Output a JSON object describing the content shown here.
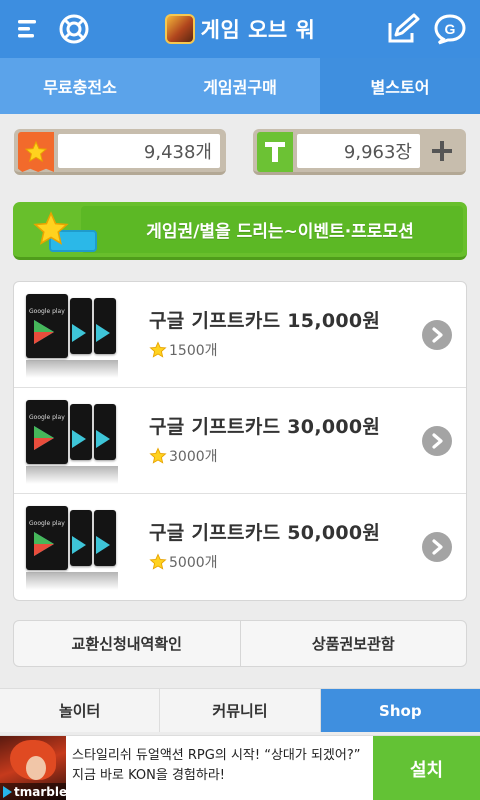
{
  "header": {
    "title": "게임 오브 워",
    "left_icons": [
      "menu-icon",
      "lifebuoy-icon"
    ],
    "right_icons": [
      "edit-icon",
      "g-chat-icon"
    ],
    "color": "#3d8ee0"
  },
  "tabs": [
    {
      "label": "무료충전소",
      "active": false
    },
    {
      "label": "게임권구매",
      "active": false
    },
    {
      "label": "별스토어",
      "active": true
    }
  ],
  "balances": {
    "stars": {
      "value": "9,438개",
      "icon": "star-icon"
    },
    "tickets": {
      "value": "9,963장",
      "icon": "t-ticket-icon",
      "add_icon": "plus-icon"
    }
  },
  "promo": {
    "label": "게임권/별을 드리는~이벤트·프로모션",
    "color": "#68bf2c"
  },
  "products": [
    {
      "name": "구글 기프트카드 15,000원",
      "price": "1500개",
      "card_brand": "Google play"
    },
    {
      "name": "구글 기프트카드 30,000원",
      "price": "3000개",
      "card_brand": "Google play"
    },
    {
      "name": "구글 기프트카드 50,000원",
      "price": "5000개",
      "card_brand": "Google play"
    }
  ],
  "actions": {
    "history": "교환신청내역확인",
    "vault": "상품권보관함"
  },
  "bottom_nav": [
    {
      "label": "놀이터",
      "active": false
    },
    {
      "label": "커뮤니티",
      "active": false
    },
    {
      "label": "Shop",
      "active": true
    }
  ],
  "ad": {
    "brand": "tmarble",
    "text": "스타일리쉬 듀얼액션 RPG의 시작! “상대가 되겠어?” 지금 바로 KON을 경험하라!",
    "install": "설치"
  }
}
